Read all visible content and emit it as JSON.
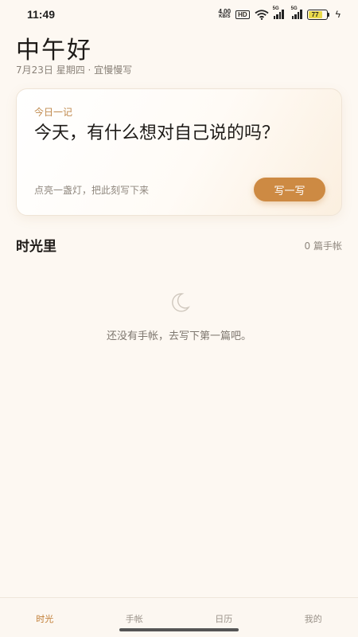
{
  "status_bar": {
    "time": "11:49",
    "net_speed": "4.00",
    "net_unit": "KB/S",
    "hd": "HD",
    "sim1_tag": "5G",
    "sim2_tag": "5G",
    "battery": "77"
  },
  "header": {
    "greeting": "中午好",
    "date_line": "7月23日 星期四 · 宜慢慢写"
  },
  "today_card": {
    "label": "今日一记",
    "prompt": "今天，有什么想对自己说的吗？",
    "hint": "点亮一盏灯，把此刻写下来",
    "button_label": "写一写"
  },
  "journal": {
    "title": "时光里",
    "count": "0 篇手帐",
    "empty_text": "还没有手帐，去写下第一篇吧。"
  },
  "tabs": [
    {
      "label": "时光",
      "active": true
    },
    {
      "label": "手帐",
      "active": false
    },
    {
      "label": "日历",
      "active": false
    },
    {
      "label": "我的",
      "active": false
    }
  ],
  "colors": {
    "accent": "#cd8a43",
    "background": "#fdf8f2",
    "active_tab": "#c07c33"
  },
  "icons": [
    "wifi-icon",
    "signal-icon",
    "battery-icon",
    "charging-icon",
    "moon-icon"
  ]
}
